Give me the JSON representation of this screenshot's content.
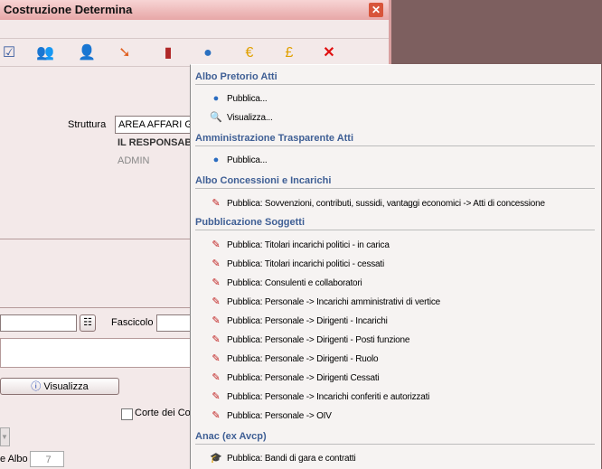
{
  "window": {
    "title": "Costruzione Determina"
  },
  "toolbar": {
    "icons": [
      "checklist-icon",
      "users-check-icon",
      "user-disabled-icon",
      "document-arrow-icon",
      "binder-icon",
      "publish-icon",
      "euro-coin-icon",
      "pound-coin-icon",
      "delete-icon"
    ]
  },
  "form": {
    "struttura_label": "Struttura",
    "struttura_value": "AREA AFFARI GI",
    "responsabile": "IL RESPONSAB",
    "admin": "ADMIN",
    "fascicolo_label": "Fascicolo",
    "visualizza_label": "Visualizza",
    "corte_label": "Corte dei Co",
    "albo_label": "e Albo",
    "albo_value": "7"
  },
  "menu": {
    "sections": [
      {
        "title": "Albo Pretorio Atti",
        "items": [
          "Pubblica...",
          "Visualizza..."
        ]
      },
      {
        "title": "Amministrazione Trasparente Atti",
        "items": [
          "Pubblica..."
        ]
      },
      {
        "title": "Albo Concessioni e Incarichi",
        "items": [
          "Pubblica: Sovvenzioni, contributi, sussidi, vantaggi economici -> Atti di concessione"
        ]
      },
      {
        "title": "Pubblicazione Soggetti",
        "items": [
          "Pubblica: Titolari incarichi politici - in carica",
          "Pubblica: Titolari incarichi politici - cessati",
          "Pubblica: Consulenti e collaboratori",
          "Pubblica: Personale -> Incarichi amministrativi di vertice",
          "Pubblica: Personale -> Dirigenti - Incarichi",
          "Pubblica: Personale -> Dirigenti - Posti funzione",
          "Pubblica: Personale -> Dirigenti - Ruolo",
          "Pubblica: Personale -> Dirigenti Cessati",
          "Pubblica: Personale -> Incarichi conferiti e autorizzati",
          "Pubblica: Personale -> OIV"
        ]
      },
      {
        "title": "Anac (ex Avcp)",
        "items": [
          "Pubblica: Bandi di gara e contratti"
        ]
      }
    ]
  }
}
